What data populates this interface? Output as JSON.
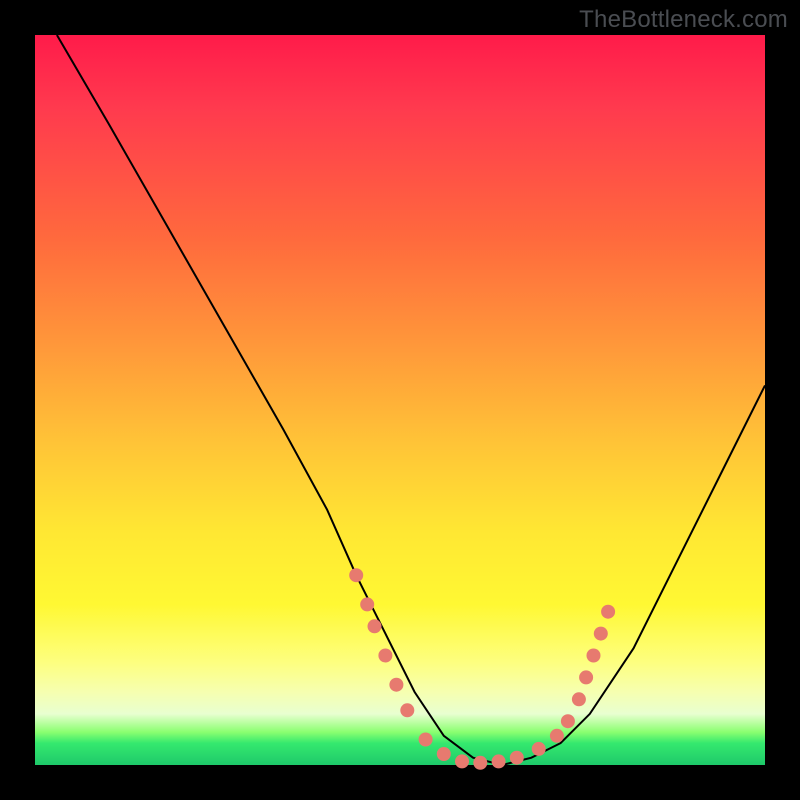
{
  "watermark": "TheBottleneck.com",
  "colors": {
    "background": "#000000",
    "gradient_top": "#ff1b4a",
    "gradient_mid": "#ffe733",
    "gradient_bottom": "#1ec96a",
    "curve": "#000000",
    "dots": "#e77a6f"
  },
  "chart_data": {
    "type": "line",
    "title": "",
    "xlabel": "",
    "ylabel": "",
    "xlim": [
      0,
      100
    ],
    "ylim": [
      0,
      100
    ],
    "grid": false,
    "series": [
      {
        "name": "curve",
        "x": [
          3,
          10,
          18,
          26,
          34,
          40,
          44,
          48,
          52,
          56,
          60,
          64,
          68,
          72,
          76,
          82,
          88,
          94,
          100
        ],
        "y": [
          100,
          88,
          74,
          60,
          46,
          35,
          26,
          18,
          10,
          4,
          1,
          0,
          1,
          3,
          7,
          16,
          28,
          40,
          52
        ]
      }
    ],
    "dots": [
      {
        "x": 44.0,
        "y": 26.0
      },
      {
        "x": 45.5,
        "y": 22.0
      },
      {
        "x": 46.5,
        "y": 19.0
      },
      {
        "x": 48.0,
        "y": 15.0
      },
      {
        "x": 49.5,
        "y": 11.0
      },
      {
        "x": 51.0,
        "y": 7.5
      },
      {
        "x": 53.5,
        "y": 3.5
      },
      {
        "x": 56.0,
        "y": 1.5
      },
      {
        "x": 58.5,
        "y": 0.5
      },
      {
        "x": 61.0,
        "y": 0.3
      },
      {
        "x": 63.5,
        "y": 0.5
      },
      {
        "x": 66.0,
        "y": 1.0
      },
      {
        "x": 69.0,
        "y": 2.2
      },
      {
        "x": 71.5,
        "y": 4.0
      },
      {
        "x": 73.0,
        "y": 6.0
      },
      {
        "x": 74.5,
        "y": 9.0
      },
      {
        "x": 75.5,
        "y": 12.0
      },
      {
        "x": 76.5,
        "y": 15.0
      },
      {
        "x": 77.5,
        "y": 18.0
      },
      {
        "x": 78.5,
        "y": 21.0
      }
    ]
  }
}
